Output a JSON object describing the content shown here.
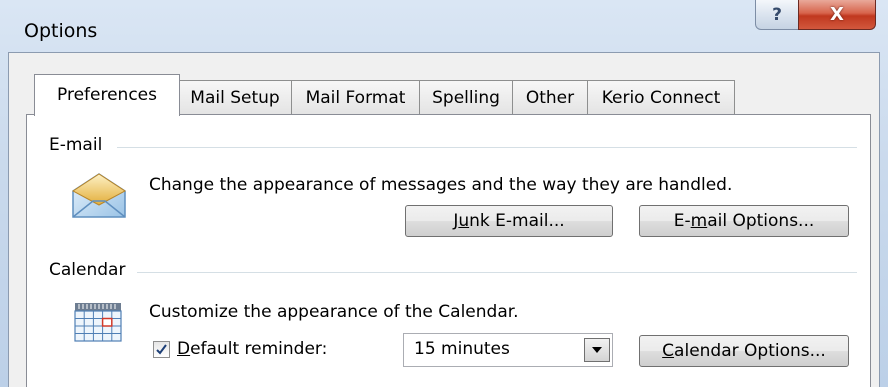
{
  "window": {
    "title": "Options",
    "help_glyph": "?",
    "close_glyph": "X"
  },
  "tabs": [
    {
      "label": "Preferences",
      "active": true
    },
    {
      "label": "Mail Setup",
      "active": false
    },
    {
      "label": "Mail Format",
      "active": false
    },
    {
      "label": "Spelling",
      "active": false
    },
    {
      "label": "Other",
      "active": false
    },
    {
      "label": "Kerio Connect",
      "active": false
    }
  ],
  "email_section": {
    "heading": "E-mail",
    "icon": "envelope-icon",
    "description": "Change the appearance of messages and the way they are handled.",
    "junk_button": {
      "pre": "J",
      "underline": "u",
      "post": "nk E-mail..."
    },
    "options_button": {
      "pre": "E-",
      "underline": "m",
      "post": "ail Options..."
    }
  },
  "calendar_section": {
    "heading": "Calendar",
    "icon": "calendar-icon",
    "description": "Customize the appearance of the Calendar.",
    "reminder_checked": true,
    "reminder_label": {
      "pre": "",
      "underline": "D",
      "post": "efault reminder:"
    },
    "reminder_value": "15 minutes",
    "options_button": {
      "pre": "",
      "underline": "C",
      "post": "alendar Options..."
    }
  },
  "colors": {
    "title_bar": "#c9d9ec",
    "close_button": "#c7442a",
    "panel": "#ffffff"
  }
}
